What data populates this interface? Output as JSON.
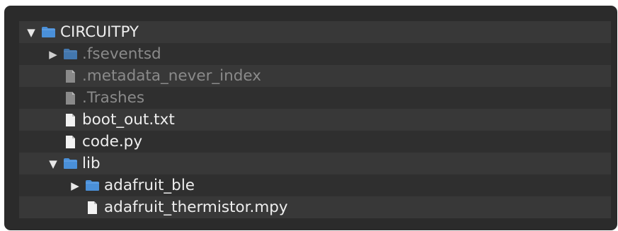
{
  "colors": {
    "folder_blue": "#4a90d9",
    "file_white": "#f2f2f2",
    "file_dim": "#8a8a8a",
    "text": "#eeeeee",
    "text_dim": "#8a8a8a"
  },
  "tree": [
    {
      "label": "CIRCUITPY",
      "depth": 0,
      "kind": "folder",
      "expanded": true,
      "dim": false,
      "icon": "folder-icon"
    },
    {
      "label": ".fseventsd",
      "depth": 1,
      "kind": "folder",
      "expanded": false,
      "dim": true,
      "icon": "folder-icon"
    },
    {
      "label": ".metadata_never_index",
      "depth": 1,
      "kind": "file",
      "dim": true,
      "icon": "file-icon"
    },
    {
      "label": ".Trashes",
      "depth": 1,
      "kind": "file",
      "dim": true,
      "icon": "file-icon"
    },
    {
      "label": "boot_out.txt",
      "depth": 1,
      "kind": "file",
      "dim": false,
      "icon": "file-icon"
    },
    {
      "label": "code.py",
      "depth": 1,
      "kind": "file",
      "dim": false,
      "icon": "file-icon"
    },
    {
      "label": "lib",
      "depth": 1,
      "kind": "folder",
      "expanded": true,
      "dim": false,
      "icon": "folder-icon"
    },
    {
      "label": "adafruit_ble",
      "depth": 2,
      "kind": "folder",
      "expanded": false,
      "dim": false,
      "icon": "folder-icon"
    },
    {
      "label": "adafruit_thermistor.mpy",
      "depth": 2,
      "kind": "file",
      "dim": false,
      "icon": "file-icon"
    }
  ]
}
